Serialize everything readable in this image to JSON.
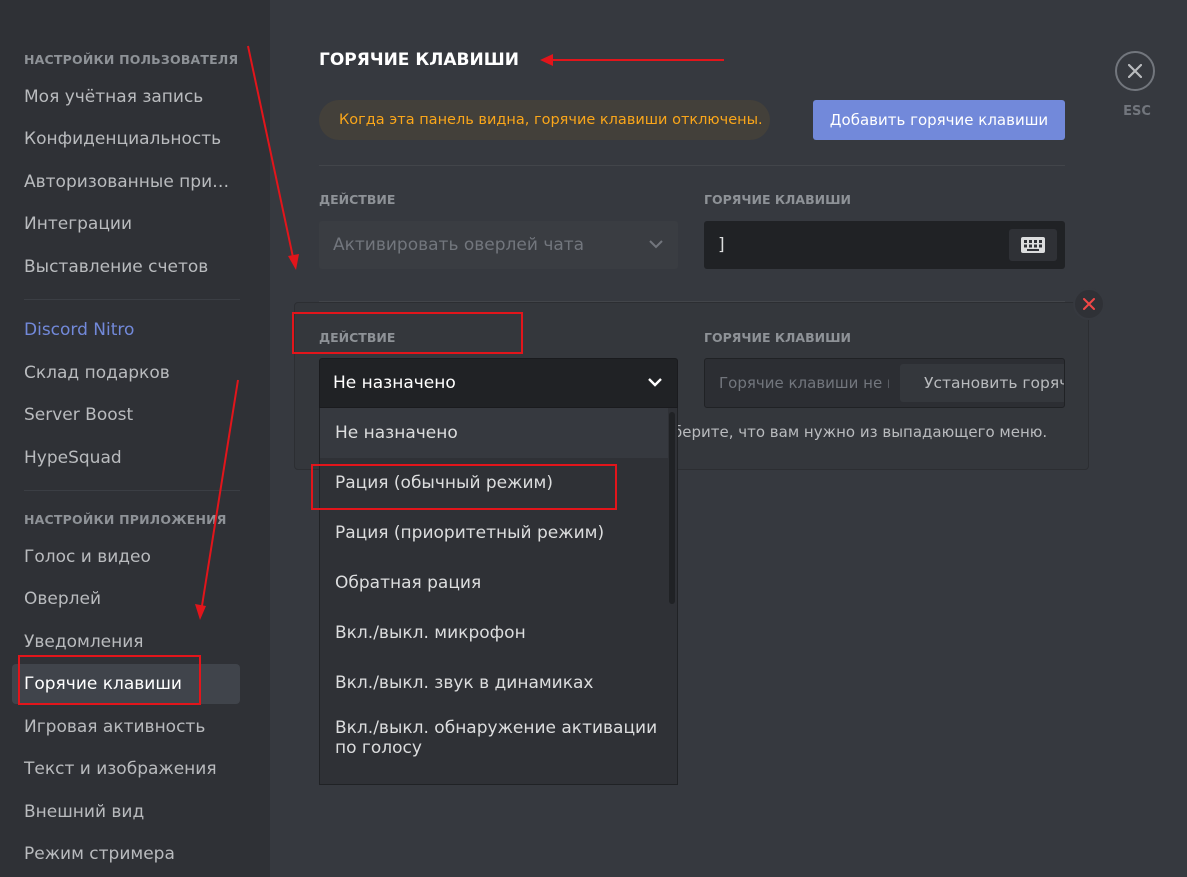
{
  "sidebar": {
    "user_settings_header": "НАСТРОЙКИ ПОЛЬЗОВАТЕЛЯ",
    "user_items": [
      "Моя учётная запись",
      "Конфиденциальность",
      "Авторизованные приложения",
      "Интеграции",
      "Выставление счетов"
    ],
    "nitro_items": [
      "Discord Nitro",
      "Склад подарков",
      "Server Boost",
      "HypeSquad"
    ],
    "app_settings_header": "НАСТРОЙКИ ПРИЛОЖЕНИЯ",
    "app_items": [
      "Голос и видео",
      "Оверлей",
      "Уведомления",
      "Горячие клавиши",
      "Игровая активность",
      "Текст и изображения",
      "Внешний вид",
      "Режим стримера"
    ],
    "active_item": "Горячие клавиши"
  },
  "header": {
    "title": "ГОРЯЧИЕ КЛАВИШИ",
    "notice": "Когда эта панель видна, горячие клавиши отключены.",
    "add_button": "Добавить горячие клавиши",
    "esc_label": "ESC"
  },
  "keybind_1": {
    "action_label": "ДЕЙСТВИЕ",
    "keybind_label": "ГОРЯЧИЕ КЛАВИШИ",
    "action_value": "Активировать оверлей чата",
    "key_value": "]"
  },
  "keybind_2": {
    "action_label": "ДЕЙСТВИЕ",
    "keybind_label": "ГОРЯЧИЕ КЛАВИШИ",
    "action_value": "Не назначено",
    "key_placeholder": "Горячие клавиши не назначены",
    "set_key_button": "Установить горячие клавиши",
    "hint": "берите, что вам нужно из выпадающего меню."
  },
  "dropdown_options": [
    "Не назначено",
    "Рация (обычный режим)",
    "Рация (приоритетный режим)",
    "Обратная рация",
    "Вкл./выкл. микрофон",
    "Вкл./выкл. звук в динамиках",
    "Вкл./выкл. обнаружение активации по голосу"
  ],
  "colors": {
    "accent": "#7289da",
    "notice_text": "#faa61a",
    "annotation_red": "#e2151b",
    "danger": "#f04747"
  },
  "icons": {
    "close": "close-icon",
    "keyboard": "keyboard-icon",
    "chevron": "chevron-down-icon",
    "remove": "remove-x-icon"
  }
}
